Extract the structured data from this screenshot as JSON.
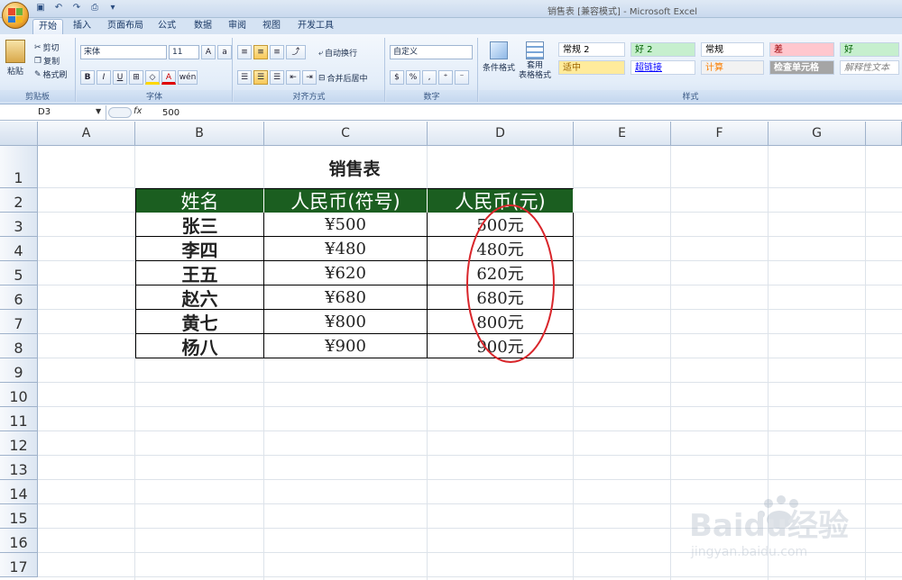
{
  "window": {
    "title": "销售表  [兼容模式] - Microsoft Excel"
  },
  "tabs": [
    {
      "label": "开始",
      "active": true
    },
    {
      "label": "插入"
    },
    {
      "label": "页面布局"
    },
    {
      "label": "公式"
    },
    {
      "label": "数据"
    },
    {
      "label": "审阅"
    },
    {
      "label": "视图"
    },
    {
      "label": "开发工具"
    }
  ],
  "ribbon": {
    "clipboard": {
      "group_label": "剪贴板",
      "paste": "粘贴",
      "cut": "剪切",
      "copy": "复制",
      "format_painter": "格式刷"
    },
    "font": {
      "group_label": "字体",
      "font_name": "宋体",
      "font_size": "11",
      "bold": "B",
      "italic": "I",
      "underline": "U",
      "phonetic": "wén"
    },
    "alignment": {
      "group_label": "对齐方式",
      "wrap": "自动换行",
      "merge": "合并后居中"
    },
    "number": {
      "group_label": "数字",
      "format": "自定义",
      "percent": "%"
    },
    "styles": {
      "group_label": "样式",
      "conditional": "条件格式",
      "table_format": "套用\n表格格式",
      "cells": [
        {
          "label": "常规 2",
          "bg": "#ffffff",
          "color": "#000000"
        },
        {
          "label": "好 2",
          "bg": "#c6efce",
          "color": "#006100"
        },
        {
          "label": "常规",
          "bg": "#ffffff",
          "color": "#000000"
        },
        {
          "label": "差",
          "bg": "#ffc7ce",
          "color": "#9c0006"
        },
        {
          "label": "好",
          "bg": "#c6efce",
          "color": "#006100"
        },
        {
          "label": "适中",
          "bg": "#ffeb9c",
          "color": "#9c6500"
        },
        {
          "label": "超链接",
          "bg": "#ffffff",
          "color": "#0000ff"
        },
        {
          "label": "计算",
          "bg": "#f2f2f2",
          "color": "#fa7d00"
        },
        {
          "label": "检查单元格",
          "bg": "#a5a5a5",
          "color": "#ffffff"
        },
        {
          "label": "解释性文本",
          "bg": "#ffffff",
          "color": "#7f7f7f"
        }
      ]
    }
  },
  "formula_bar": {
    "name_box": "D3",
    "fx": "fx",
    "value": "500"
  },
  "columns": [
    "A",
    "B",
    "C",
    "D",
    "E",
    "F",
    "G"
  ],
  "rows": [
    "1",
    "2",
    "3",
    "4",
    "5",
    "6",
    "7",
    "8",
    "9",
    "10",
    "11",
    "12",
    "13",
    "14",
    "15",
    "16",
    "17"
  ],
  "sheet": {
    "title": "销售表",
    "headers": [
      "姓名",
      "人民币(符号)",
      "人民币(元)"
    ],
    "header_bg": "#1b5e20",
    "records": [
      {
        "name": "张三",
        "sym": "¥500",
        "yuan": "500元"
      },
      {
        "name": "李四",
        "sym": "¥480",
        "yuan": "480元"
      },
      {
        "name": "王五",
        "sym": "¥620",
        "yuan": "620元"
      },
      {
        "name": "赵六",
        "sym": "¥680",
        "yuan": "680元"
      },
      {
        "name": "黄七",
        "sym": "¥800",
        "yuan": "800元"
      },
      {
        "name": "杨八",
        "sym": "¥900",
        "yuan": "900元"
      }
    ],
    "annotation_color": "#d9262b"
  },
  "watermark": {
    "brand": "Baidu经验",
    "url": "jingyan.baidu.com"
  }
}
